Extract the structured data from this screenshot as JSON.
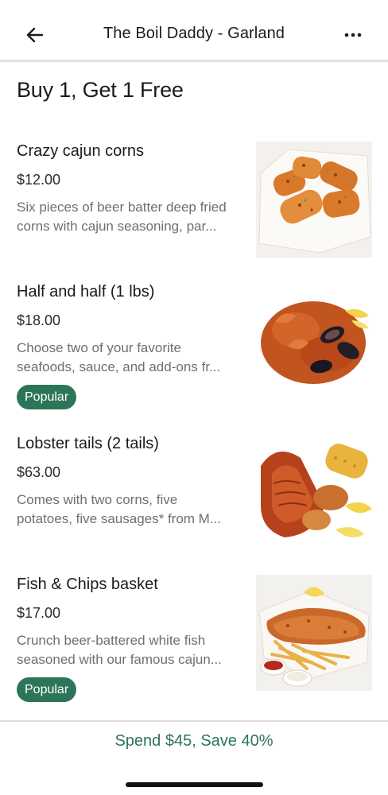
{
  "header": {
    "title": "The Boil Daddy - Garland",
    "back_icon": "arrow-left-icon",
    "more_icon": "more-horizontal-icon"
  },
  "section": {
    "title": "Buy 1, Get 1 Free"
  },
  "items": [
    {
      "name": "Crazy cajun corns",
      "price": "$12.00",
      "desc_line1": "Six pieces of beer batter deep fried",
      "desc_line2": "corns with cajun seasoning, par...",
      "badge": ""
    },
    {
      "name": "Half and half (1 lbs)",
      "price": "$18.00",
      "desc_line1": "Choose two of your favorite",
      "desc_line2": "seafoods, sauce, and add-ons fr...",
      "badge": "Popular"
    },
    {
      "name": "Lobster tails (2 tails)",
      "price": "$63.00",
      "desc_line1": "Comes with two corns, five",
      "desc_line2": "potatoes, five sausages* from M...",
      "badge": ""
    },
    {
      "name": "Fish & Chips basket",
      "price": "$17.00",
      "desc_line1": "Crunch beer-battered white fish",
      "desc_line2": "seasoned with our famous cajun...",
      "badge": "Popular"
    }
  ],
  "footer": {
    "promo": "Spend $45, Save 40%"
  },
  "colors": {
    "accent": "#2d7559",
    "text": "#1b1b1b",
    "muted": "#6f6f6f"
  }
}
